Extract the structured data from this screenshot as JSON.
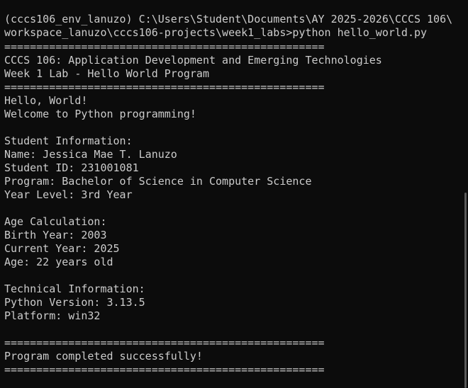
{
  "terminal": {
    "prompt_line_1": "(cccs106_env_lanuzo) C:\\Users\\Student\\Documents\\AY 2025-2026\\CCCS 106\\",
    "prompt_line_2": "workspace_lanuzo\\cccs106-projects\\week1_labs>python hello_world.py",
    "separator": "==================================================",
    "course_title": "CCCS 106: Application Development and Emerging Technologies",
    "lab_title": "Week 1 Lab - Hello World Program",
    "greeting": "Hello, World!",
    "welcome": "Welcome to Python programming!",
    "student_header": "Student Information:",
    "name": "Name: Jessica Mae T. Lanuzo",
    "student_id": "Student ID: 231001081",
    "program": "Program: Bachelor of Science in Computer Science",
    "year_level": "Year Level: 3rd Year",
    "age_header": "Age Calculation:",
    "birth_year": "Birth Year: 2003",
    "current_year": "Current Year: 2025",
    "age": "Age: 22 years old",
    "tech_header": "Technical Information:",
    "python_version": "Python Version: 3.13.5",
    "platform": "Platform: win32",
    "completed": "Program completed successfully!"
  }
}
